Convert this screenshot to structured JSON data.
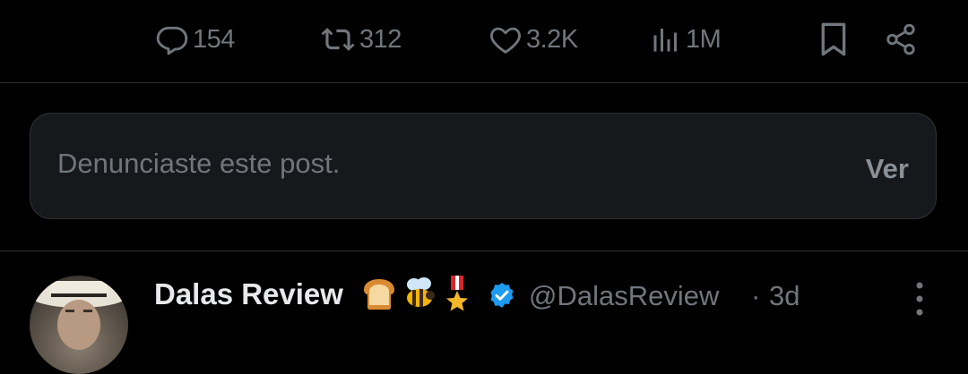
{
  "actions": {
    "reply_count": "154",
    "repost_count": "312",
    "like_count": "3.2K",
    "views_count": "1M"
  },
  "icons": {
    "reply": "reply-icon",
    "repost": "repost-icon",
    "like": "heart-icon",
    "views": "views-icon",
    "bookmark": "bookmark-icon",
    "share": "share-icon",
    "verified": "verified-badge-icon",
    "more": "more-vertical-icon"
  },
  "reported": {
    "message": "Denunciaste este post.",
    "view_label": "Ver"
  },
  "next_post": {
    "author_name": "Dalas Review",
    "emojis": [
      "bread-emoji",
      "bee-emoji",
      "medal-emoji"
    ],
    "handle": "@DalasReview",
    "separator": "·",
    "time": "3d"
  },
  "colors": {
    "background": "#000000",
    "muted": "#71767b",
    "verified": "#1d9bf0",
    "card": "#16181c",
    "border": "#2f3336"
  }
}
